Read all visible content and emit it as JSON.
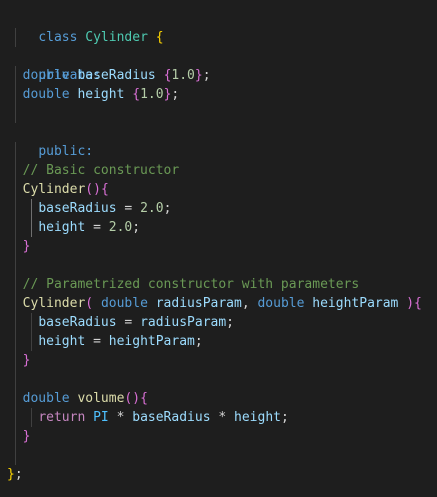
{
  "editor": {
    "language": "C++",
    "theme_colors": {
      "background": "#1e1e1e",
      "keyword": "#569cd6",
      "class_name": "#4ec9b0",
      "function": "#dcdcaa",
      "variable": "#9cdcfe",
      "number": "#b5cea8",
      "comment": "#6a9955",
      "bracket_level1": "#ffd700",
      "bracket_level2": "#da70d6",
      "bracket_level3": "#179fff"
    },
    "lines": [
      {
        "t": [
          "class",
          " ",
          "Cylinder",
          " ",
          "{"
        ]
      },
      {
        "t": []
      },
      {
        "t": [
          "private:"
        ]
      },
      {
        "t": [
          "  ",
          "double",
          " ",
          "baseRadius",
          " ",
          "{",
          "1.0",
          "}",
          ";"
        ]
      },
      {
        "t": [
          "  ",
          "double",
          " ",
          "height",
          " ",
          "{",
          "1.0",
          "}",
          ";"
        ]
      },
      {
        "t": []
      },
      {
        "t": [
          "public:"
        ]
      },
      {
        "t": []
      },
      {
        "t": [
          "  ",
          "// Basic constructor"
        ]
      },
      {
        "t": [
          "  ",
          "Cylinder",
          "(",
          ")",
          "{"
        ]
      },
      {
        "t": [
          "    ",
          "baseRadius",
          " = ",
          "2.0",
          ";"
        ]
      },
      {
        "t": [
          "    ",
          "height",
          " = ",
          "2.0",
          ";"
        ]
      },
      {
        "t": [
          "  ",
          "}"
        ]
      },
      {
        "t": []
      },
      {
        "t": [
          "  ",
          "// Parametrized constructor with parameters"
        ]
      },
      {
        "t": [
          "  ",
          "Cylinder",
          "(",
          " ",
          "double",
          " ",
          "radiusParam",
          ", ",
          "double",
          " ",
          "heightParam",
          " ",
          ")",
          "{"
        ]
      },
      {
        "t": [
          "    ",
          "baseRadius",
          " = ",
          "radiusParam",
          ";"
        ]
      },
      {
        "t": [
          "    ",
          "height",
          " = ",
          "heightParam",
          ";"
        ]
      },
      {
        "t": [
          "  ",
          "}"
        ]
      },
      {
        "t": []
      },
      {
        "t": [
          "  ",
          "double",
          " ",
          "volume",
          "(",
          ")",
          "{"
        ]
      },
      {
        "t": [
          "    ",
          "return",
          " ",
          "PI",
          " * ",
          "baseRadius",
          " * ",
          "height",
          ";"
        ]
      },
      {
        "t": [
          "  ",
          "}"
        ]
      },
      {
        "t": []
      },
      {
        "t": [
          "}",
          ";"
        ]
      }
    ]
  }
}
